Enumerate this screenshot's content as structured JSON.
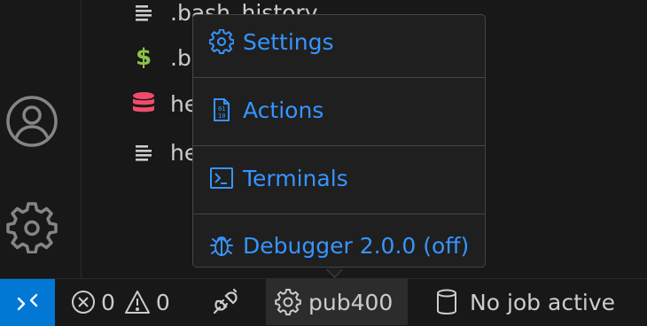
{
  "explorer": {
    "files": [
      {
        "name": ".bash_history",
        "icon": "list-icon"
      },
      {
        "name": ".b",
        "icon": "dollar-icon"
      },
      {
        "name": "he",
        "icon": "database-icon"
      },
      {
        "name": "he",
        "icon": "list-icon"
      }
    ]
  },
  "menu": {
    "items": [
      {
        "label": "Settings",
        "icon": "gear-icon"
      },
      {
        "label": "Actions",
        "icon": "binary-file-icon"
      },
      {
        "label": "Terminals",
        "icon": "terminal-icon"
      },
      {
        "label": "Debugger 2.0.0 (off)",
        "icon": "bug-icon"
      }
    ]
  },
  "status": {
    "errors": "0",
    "warnings": "0",
    "connection": "pub400",
    "job": "No job active"
  },
  "colors": {
    "accent": "#3794ff",
    "remote": "#0078d4",
    "dollar": "#8dc149",
    "database": "#f14c6b"
  }
}
